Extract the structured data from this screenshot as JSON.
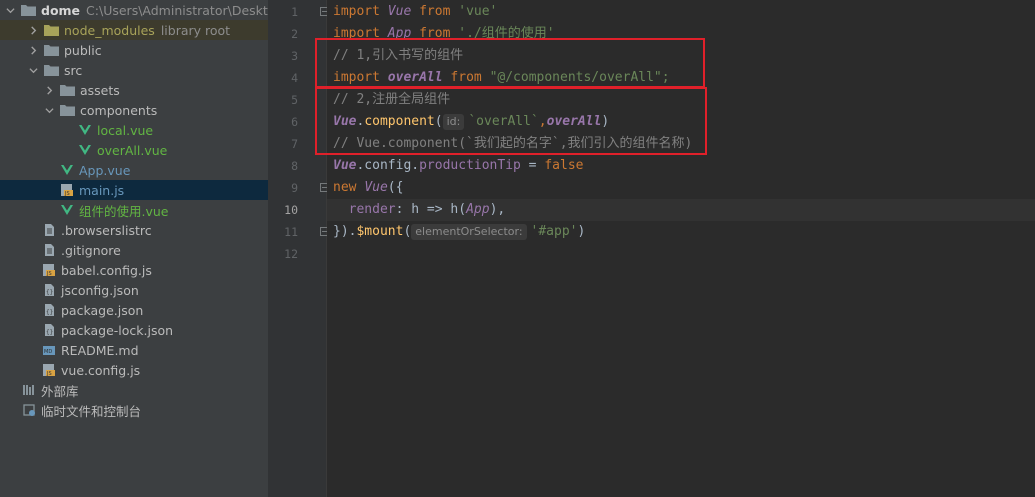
{
  "sidebar": {
    "root": {
      "name": "dome",
      "path": "C:\\Users\\Administrator\\Desktop"
    },
    "items": [
      {
        "label": "node_modules",
        "hint": "library root"
      },
      {
        "label": "public"
      },
      {
        "label": "src"
      },
      {
        "label": "assets"
      },
      {
        "label": "components"
      },
      {
        "label": "local.vue"
      },
      {
        "label": "overAll.vue"
      },
      {
        "label": "App.vue"
      },
      {
        "label": "main.js"
      },
      {
        "label": "组件的使用.vue"
      },
      {
        "label": ".browserslistrc"
      },
      {
        "label": ".gitignore"
      },
      {
        "label": "babel.config.js"
      },
      {
        "label": "jsconfig.json"
      },
      {
        "label": "package.json"
      },
      {
        "label": "package-lock.json"
      },
      {
        "label": "README.md"
      },
      {
        "label": "vue.config.js"
      },
      {
        "label": "外部库"
      },
      {
        "label": "临时文件和控制台"
      }
    ]
  },
  "gutter": {
    "line_numbers": [
      "1",
      "2",
      "3",
      "4",
      "5",
      "6",
      "7",
      "8",
      "9",
      "10",
      "11",
      "12"
    ],
    "current_line": "10"
  },
  "editor": {
    "line1": {
      "import": "import",
      "name": "Vue",
      "from": "from",
      "src": "'vue'"
    },
    "line2": {
      "import": "import",
      "name": "App",
      "from": "from",
      "src": "'./组件的使用'"
    },
    "line3": {
      "comment": "// 1,引入书写的组件"
    },
    "line4": {
      "import": "import",
      "name": "overAll",
      "from": "from",
      "src": "\"@/components/overAll\";"
    },
    "line5": {
      "comment": "// 2,注册全局组件"
    },
    "line6": {
      "obj": "Vue",
      "dot": ".",
      "method": "component",
      "open": "(",
      "hint": "id:",
      "arg1": "`overAll`",
      "comma": ",",
      "arg2": "overAll",
      "close": ")"
    },
    "line7": {
      "comment": "// Vue.component(`我们起的名字`,我们引入的组件名称)"
    },
    "line8": {
      "obj": "Vue",
      "rest": ".config.",
      "prop": "productionTip",
      "eq": " = ",
      "val": "false"
    },
    "line9": {
      "kw": "new",
      "cls": "Vue",
      "rest": "({"
    },
    "line10": {
      "indent": "  ",
      "prop": "render",
      "rest": ": h => h(",
      "arg": "App",
      "close": "),"
    },
    "line11": {
      "lead": "}).",
      "fn": "$mount",
      "open": "(",
      "hint": "elementOrSelector:",
      "arg": "'#app'",
      "close": ")"
    }
  },
  "highlight_color": "#e0202a"
}
